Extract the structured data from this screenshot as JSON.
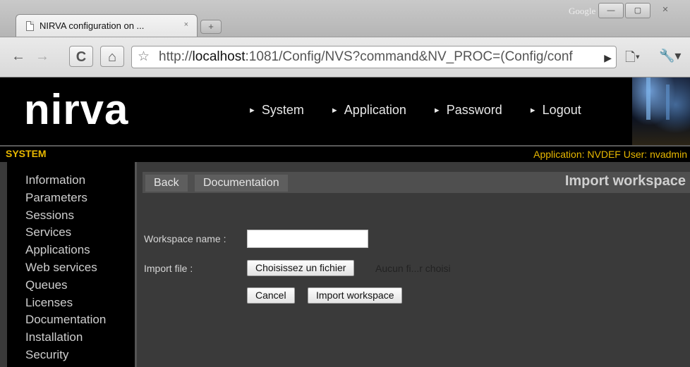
{
  "browser": {
    "tab_title": "NIRVA configuration on ...",
    "tab_close": "×",
    "new_tab": "+",
    "brand": "Google",
    "window_buttons": [
      "—",
      "▢",
      "✕"
    ],
    "url_prefix": "http://",
    "url_host": "localhost",
    "url_rest": ":1081/Config/NVS?command&NV_PROC=(Config/conf"
  },
  "site": {
    "logo": "nirva",
    "nav": [
      "System",
      "Application",
      "Password",
      "Logout"
    ],
    "section_title": "SYSTEM",
    "app_info": "Application: NVDEF   User: nvadmin"
  },
  "sidebar": {
    "items": [
      "Information",
      "Parameters",
      "Sessions",
      "Services",
      "Applications",
      "Web services",
      "Queues",
      "Licenses",
      "Documentation",
      "Installation",
      "Security"
    ]
  },
  "main": {
    "back_label": "Back",
    "doc_label": "Documentation",
    "page_title": "Import workspace",
    "workspace_name_label": "Workspace name :",
    "workspace_name_value": "",
    "import_file_label": "Import file :",
    "choose_file_label": "Choisissez un fichier",
    "file_status": "Aucun fi...r choisi",
    "cancel_label": "Cancel",
    "import_label": "Import workspace"
  },
  "colors": {
    "accent_yellow": "#e8b800",
    "header_bg": "#000000",
    "content_bg": "#3a3a3a"
  }
}
